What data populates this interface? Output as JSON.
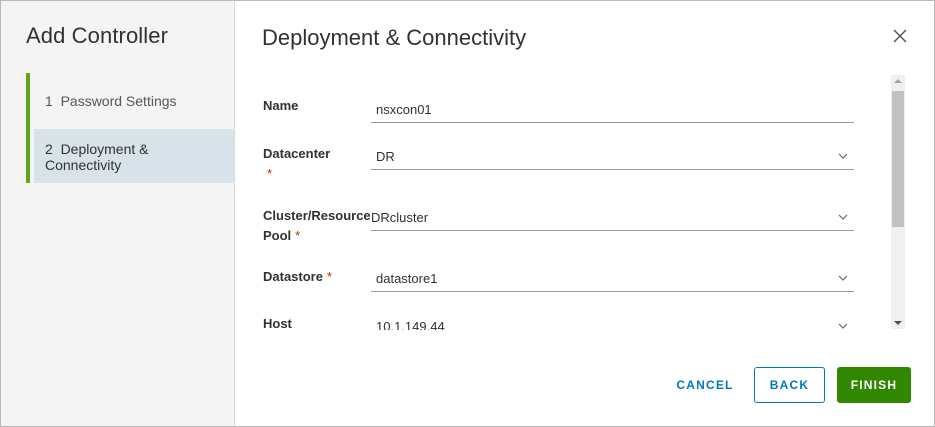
{
  "sidebar": {
    "title": "Add Controller",
    "steps": [
      {
        "label": "1  Password Settings"
      },
      {
        "label": "2  Deployment & Connectivity"
      }
    ]
  },
  "main": {
    "title": "Deployment & Connectivity",
    "close_icon": "close-icon"
  },
  "form": {
    "name": {
      "label": "Name",
      "value": "nsxcon01"
    },
    "datacenter": {
      "label": "Datacenter",
      "required": "*",
      "value": "DR"
    },
    "cluster": {
      "label": "Cluster/Resource Pool",
      "required": "*",
      "value": "DRcluster"
    },
    "datastore": {
      "label": "Datastore",
      "required": "*",
      "value": "datastore1"
    },
    "host": {
      "label": "Host",
      "value": "10.1.149.44"
    }
  },
  "buttons": {
    "cancel": "CANCEL",
    "back": "BACK",
    "finish": "FINISH"
  },
  "colors": {
    "accent": "#0079b8",
    "finish": "#318700",
    "step_active_bar": "#62a420",
    "required": "#c92100"
  }
}
